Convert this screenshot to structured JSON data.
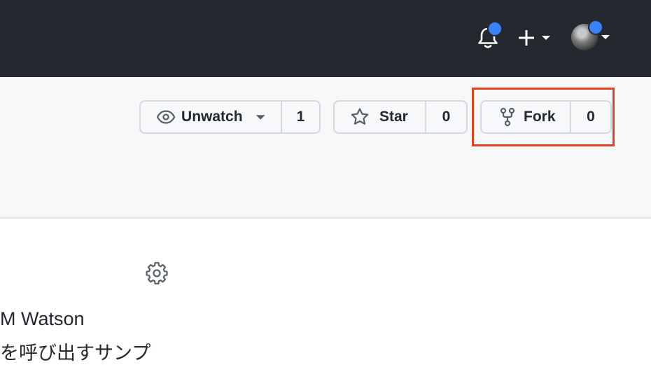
{
  "header": {
    "icons": [
      "bell-icon",
      "plus-icon",
      "caret-down-icon",
      "avatar"
    ],
    "notification_dot_color": "#3b82f6",
    "background": "#24292f"
  },
  "repo_actions": {
    "watch": {
      "label": "Unwatch",
      "count": "1",
      "icon": "eye-icon"
    },
    "star": {
      "label": "Star",
      "count": "0",
      "icon": "star-icon"
    },
    "fork": {
      "label": "Fork",
      "count": "0",
      "icon": "repo-forked-icon"
    },
    "highlight_color": "#e0431f"
  },
  "about": {
    "icon": "gear-icon",
    "title": "M Watson",
    "description": "を呼び出すサンプ"
  }
}
